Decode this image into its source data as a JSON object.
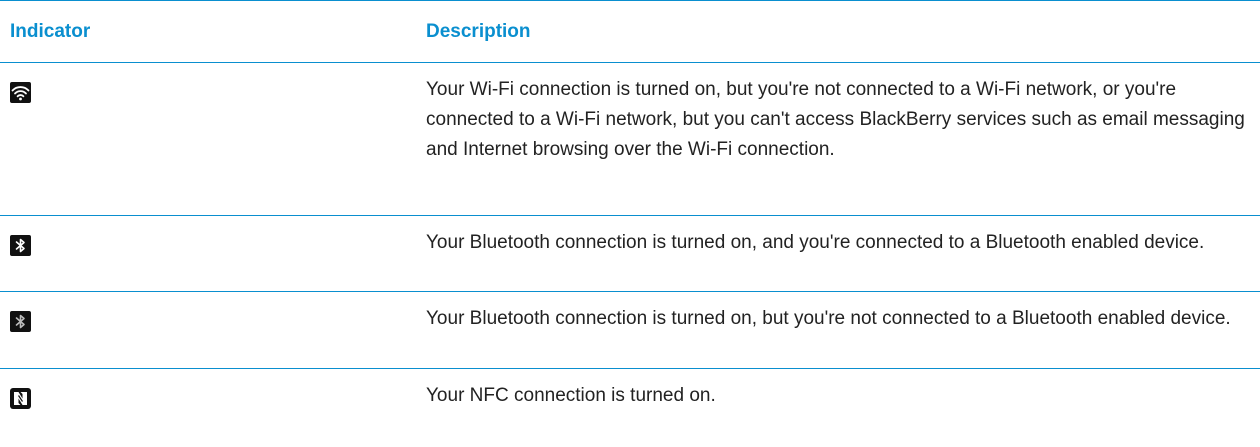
{
  "table": {
    "headers": {
      "indicator": "Indicator",
      "description": "Description"
    },
    "rows": [
      {
        "icon": "wifi-icon",
        "description": "Your Wi-Fi connection is turned on, but you're not connected to a Wi-Fi network, or you're connected to a Wi-Fi network, but you can't access BlackBerry services such as email messaging and Internet browsing over the Wi-Fi connection."
      },
      {
        "icon": "bluetooth-connected-icon",
        "description": "Your Bluetooth connection is turned on, and you're connected to a Bluetooth enabled device."
      },
      {
        "icon": "bluetooth-on-icon",
        "description": "Your Bluetooth connection is turned on, but you're not connected to a Bluetooth enabled device."
      },
      {
        "icon": "nfc-icon",
        "description": "Your NFC connection is turned on."
      }
    ]
  },
  "colors": {
    "accent": "#0a8fcf",
    "text": "#222222",
    "icon_bg": "#111111",
    "icon_fg": "#ffffff",
    "icon_fg_dim": "#bdbdbd"
  }
}
